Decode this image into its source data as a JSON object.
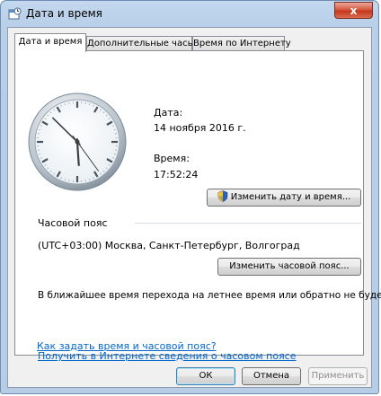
{
  "window": {
    "title": "Дата и время",
    "close_symbol": "x"
  },
  "tabs": [
    {
      "label": "Дата и время",
      "active": true
    },
    {
      "label": "Дополнительные часы",
      "active": false
    },
    {
      "label": "Время по Интернету",
      "active": false
    }
  ],
  "datetime": {
    "date_label": "Дата:",
    "date_value": "14 ноября 2016 г.",
    "time_label": "Время:",
    "time_value": "17:52:24",
    "change_button": "Изменить дату и время..."
  },
  "timezone": {
    "group_label": "Часовой пояс",
    "value": "(UTC+03:00) Москва, Санкт-Петербург, Волгоград",
    "change_button": "Изменить часовой пояс...",
    "dst_note": "В ближайшее время перехода на летнее время или обратно не будет."
  },
  "links": {
    "online_info": "Получить в Интернете сведения о часовом поясе",
    "how_to": "Как задать время и часовой пояс?"
  },
  "footer": {
    "ok": "ОК",
    "cancel": "Отмена",
    "apply": "Применить"
  },
  "clock": {
    "hours": 17,
    "minutes": 52,
    "seconds": 24
  },
  "colors": {
    "link": "#0066cc",
    "frame": "#b9cfe8",
    "close": "#c3381f"
  }
}
